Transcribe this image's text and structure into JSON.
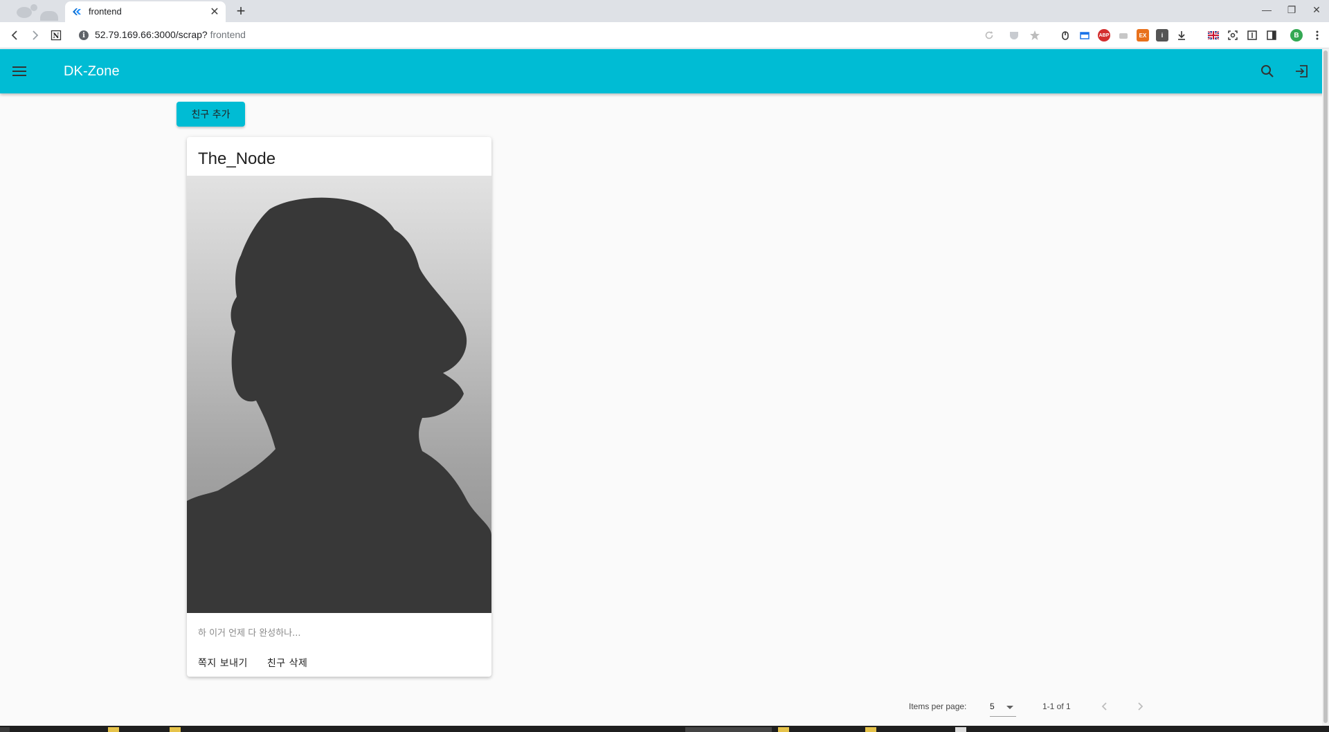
{
  "browser": {
    "tab_title": "frontend",
    "url": "52.79.169.66:3000/scrap?",
    "url_suffix": "frontend",
    "colors": {
      "tabbar": "#dee1e6",
      "toolbar": "#ffffff"
    },
    "icons": [
      "back-icon",
      "forward-icon",
      "notion-icon",
      "info-icon",
      "reload-icon",
      "pocket-icon",
      "star-icon",
      "extension-icons",
      "download-icon",
      "flag-uk-icon",
      "screenshot-icon",
      "reader-icon",
      "sidebar-icon",
      "profile-icon",
      "menu-dots-icon"
    ],
    "profile_initial": "B",
    "ext_abp": "ABP",
    "ext_ex": "EX"
  },
  "app": {
    "title": "DK-Zone",
    "colors": {
      "primary": "#00bcd4",
      "background": "#fafafa"
    }
  },
  "actions": {
    "add_friend_label": "친구 추가"
  },
  "card": {
    "name": "The_Node",
    "status_message": "하 이거 언제 다 완성하나...",
    "send_message_label": "쪽지 보내기",
    "delete_friend_label": "친구 삭제"
  },
  "paginator": {
    "items_per_page_label": "Items per page:",
    "page_size": "5",
    "range_label": "1-1 of 1"
  }
}
